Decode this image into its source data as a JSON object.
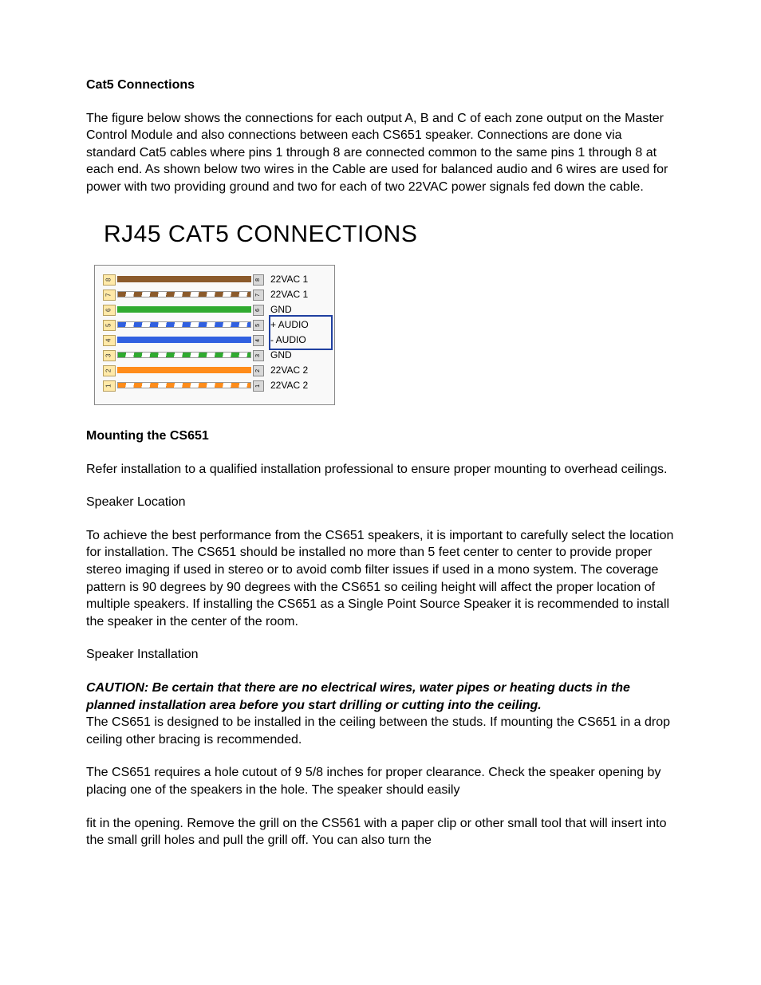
{
  "h1": "Cat5 Connections",
  "p1": "The figure below shows the connections for each output A, B and C of each zone output on the Master Control Module and also connections between each CS651 speaker.  Connections are done via standard Cat5 cables where pins 1 through 8 are connected common to the same pins 1 through 8 at each end.  As shown below two wires in the Cable are used for balanced audio and 6 wires are used for power with two providing ground and two for each of two 22VAC power signals fed down the cable.",
  "diagramTitle": "RJ45 CAT5 CONNECTIONS",
  "pins": [
    {
      "num": "8",
      "color": "#8b5a2b",
      "type": "solid",
      "signal": "22VAC 1"
    },
    {
      "num": "7",
      "color": "#8b5a2b",
      "type": "striped",
      "signal": "22VAC 1"
    },
    {
      "num": "6",
      "color": "#2faa2f",
      "type": "solid",
      "signal": "GND"
    },
    {
      "num": "5",
      "color": "#3060e0",
      "type": "striped",
      "signal": "+ AUDIO"
    },
    {
      "num": "4",
      "color": "#3060e0",
      "type": "solid",
      "signal": "- AUDIO"
    },
    {
      "num": "3",
      "color": "#2faa2f",
      "type": "striped",
      "signal": "GND"
    },
    {
      "num": "2",
      "color": "#ff8c1a",
      "type": "solid",
      "signal": "22VAC 2"
    },
    {
      "num": "1",
      "color": "#ff8c1a",
      "type": "striped",
      "signal": "22VAC 2"
    }
  ],
  "h2": "Mounting the CS651",
  "p2": "Refer installation to a qualified installation professional to ensure proper mounting to overhead ceilings.",
  "sh1": "Speaker Location",
  "p3": "To achieve the best performance from the CS651 speakers, it is important to carefully select the location for installation.  The CS651 should be installed no more than 5 feet center to center to provide proper stereo imaging if used in stereo or to avoid comb filter issues if used in a mono system.  The coverage pattern is 90 degrees by 90 degrees with the CS651 so ceiling height will affect the proper location of multiple speakers.  If installing the CS651 as a Single Point Source Speaker it is recommended to install the speaker in the center of the room.",
  "sh2": "Speaker Installation",
  "caution": "CAUTION: Be certain that there are no electrical wires, water pipes or heating ducts in the planned installation area before you start drilling or cutting into the ceiling.",
  "p4": "The CS651 is designed to be installed in the ceiling between the studs.  If mounting the CS651 in a drop ceiling other bracing is recommended.",
  "p5": "The CS651 requires a hole cutout of 9 5/8 inches for proper clearance.  Check the speaker opening by placing one of the speakers in the hole.  The speaker should easily",
  "p6": "fit in the opening.   Remove the grill on the CS561 with a paper clip or other small tool that will insert into the small grill holes and pull the grill off.  You can also turn the"
}
